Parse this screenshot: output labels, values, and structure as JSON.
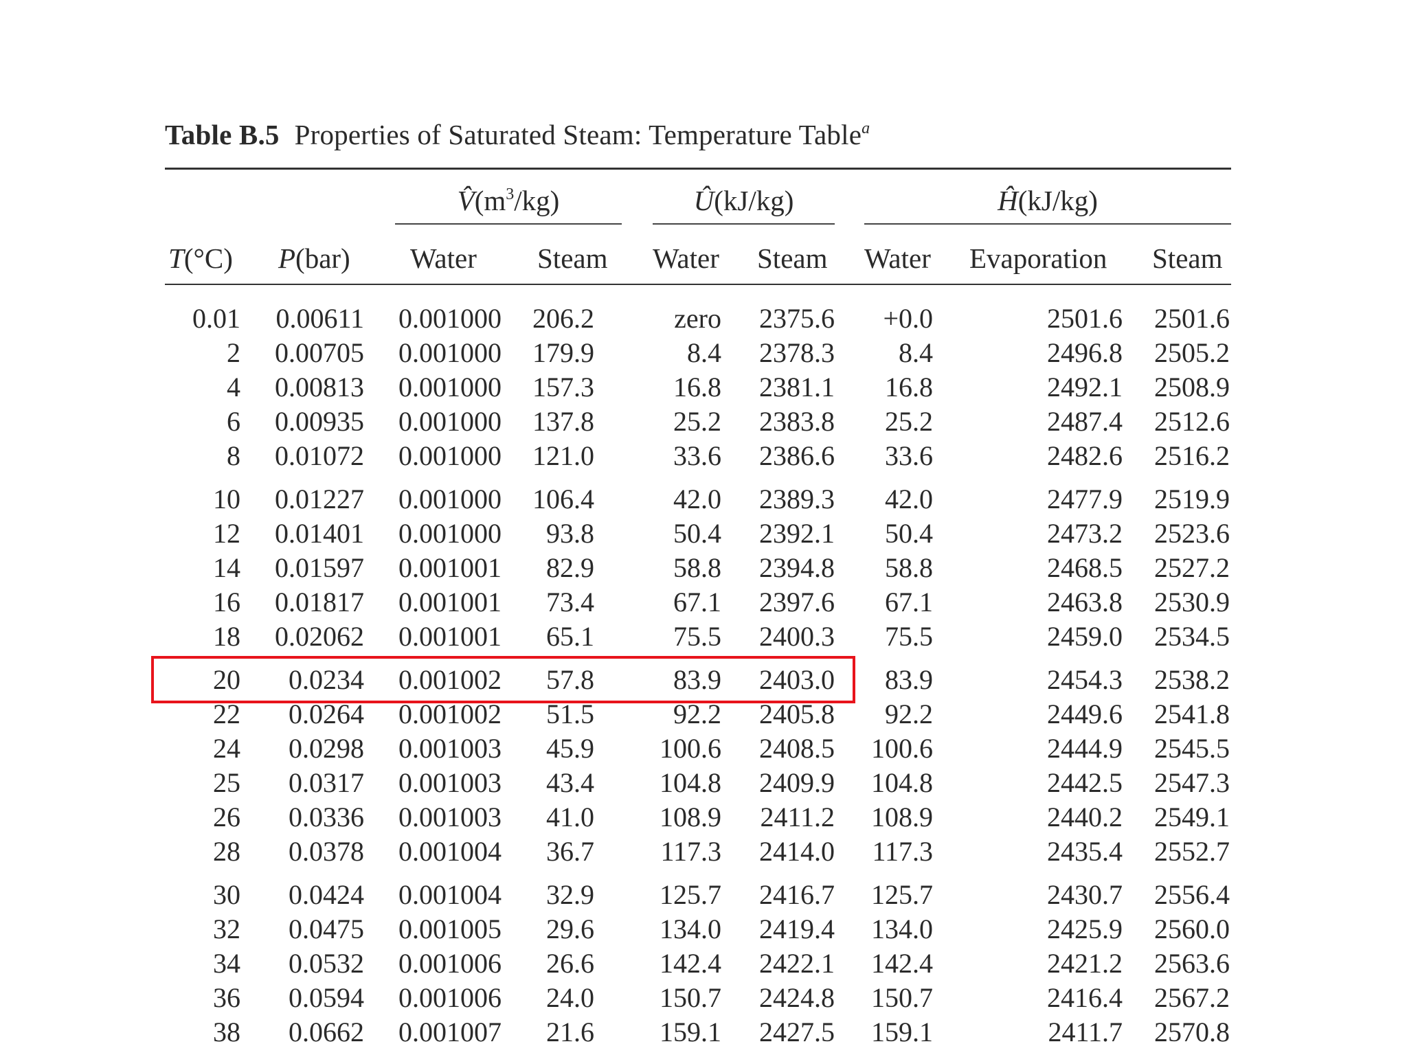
{
  "table": {
    "label": "Table B.5",
    "title": "Properties of Saturated Steam: Temperature Table",
    "footnote_mark": "a",
    "groups": [
      {
        "symbol": "V̂",
        "unit": "(m",
        "unit_sup": "3",
        "unit_tail": "/kg)"
      },
      {
        "symbol": "Û",
        "unit": "(kJ/kg)",
        "unit_sup": "",
        "unit_tail": ""
      },
      {
        "symbol": "Ĥ",
        "unit": "(kJ/kg)",
        "unit_sup": "",
        "unit_tail": ""
      }
    ],
    "columns": [
      {
        "sym": "T",
        "text": "(°C)"
      },
      {
        "sym": "P",
        "text": "(bar)"
      },
      {
        "sym": "",
        "text": "Water"
      },
      {
        "sym": "",
        "text": "Steam"
      },
      {
        "sym": "",
        "text": "Water"
      },
      {
        "sym": "",
        "text": "Steam"
      },
      {
        "sym": "",
        "text": "Water"
      },
      {
        "sym": "",
        "text": "Evaporation"
      },
      {
        "sym": "",
        "text": "Steam"
      }
    ],
    "rows": [
      [
        "0.01",
        "0.00611",
        "0.001000",
        "206.2",
        "zero",
        "2375.6",
        "+0.0",
        "2501.6",
        "2501.6"
      ],
      [
        "2",
        "0.00705",
        "0.001000",
        "179.9",
        "8.4",
        "2378.3",
        "8.4",
        "2496.8",
        "2505.2"
      ],
      [
        "4",
        "0.00813",
        "0.001000",
        "157.3",
        "16.8",
        "2381.1",
        "16.8",
        "2492.1",
        "2508.9"
      ],
      [
        "6",
        "0.00935",
        "0.001000",
        "137.8",
        "25.2",
        "2383.8",
        "25.2",
        "2487.4",
        "2512.6"
      ],
      [
        "8",
        "0.01072",
        "0.001000",
        "121.0",
        "33.6",
        "2386.6",
        "33.6",
        "2482.6",
        "2516.2"
      ],
      [
        "10",
        "0.01227",
        "0.001000",
        "106.4",
        "42.0",
        "2389.3",
        "42.0",
        "2477.9",
        "2519.9"
      ],
      [
        "12",
        "0.01401",
        "0.001000",
        "93.8",
        "50.4",
        "2392.1",
        "50.4",
        "2473.2",
        "2523.6"
      ],
      [
        "14",
        "0.01597",
        "0.001001",
        "82.9",
        "58.8",
        "2394.8",
        "58.8",
        "2468.5",
        "2527.2"
      ],
      [
        "16",
        "0.01817",
        "0.001001",
        "73.4",
        "67.1",
        "2397.6",
        "67.1",
        "2463.8",
        "2530.9"
      ],
      [
        "18",
        "0.02062",
        "0.001001",
        "65.1",
        "75.5",
        "2400.3",
        "75.5",
        "2459.0",
        "2534.5"
      ],
      [
        "20",
        "0.0234",
        "0.001002",
        "57.8",
        "83.9",
        "2403.0",
        "83.9",
        "2454.3",
        "2538.2"
      ],
      [
        "22",
        "0.0264",
        "0.001002",
        "51.5",
        "92.2",
        "2405.8",
        "92.2",
        "2449.6",
        "2541.8"
      ],
      [
        "24",
        "0.0298",
        "0.001003",
        "45.9",
        "100.6",
        "2408.5",
        "100.6",
        "2444.9",
        "2545.5"
      ],
      [
        "25",
        "0.0317",
        "0.001003",
        "43.4",
        "104.8",
        "2409.9",
        "104.8",
        "2442.5",
        "2547.3"
      ],
      [
        "26",
        "0.0336",
        "0.001003",
        "41.0",
        "108.9",
        "2411.2",
        "108.9",
        "2440.2",
        "2549.1"
      ],
      [
        "28",
        "0.0378",
        "0.001004",
        "36.7",
        "117.3",
        "2414.0",
        "117.3",
        "2435.4",
        "2552.7"
      ],
      [
        "30",
        "0.0424",
        "0.001004",
        "32.9",
        "125.7",
        "2416.7",
        "125.7",
        "2430.7",
        "2556.4"
      ],
      [
        "32",
        "0.0475",
        "0.001005",
        "29.6",
        "134.0",
        "2419.4",
        "134.0",
        "2425.9",
        "2560.0"
      ],
      [
        "34",
        "0.0532",
        "0.001006",
        "26.6",
        "142.4",
        "2422.1",
        "142.4",
        "2421.2",
        "2563.6"
      ],
      [
        "36",
        "0.0594",
        "0.001006",
        "24.0",
        "150.7",
        "2424.8",
        "150.7",
        "2416.4",
        "2567.2"
      ],
      [
        "38",
        "0.0662",
        "0.001007",
        "21.6",
        "159.1",
        "2427.5",
        "159.1",
        "2411.7",
        "2570.8"
      ]
    ]
  },
  "highlight": {
    "row_index": 10,
    "color": "#e8141c"
  }
}
